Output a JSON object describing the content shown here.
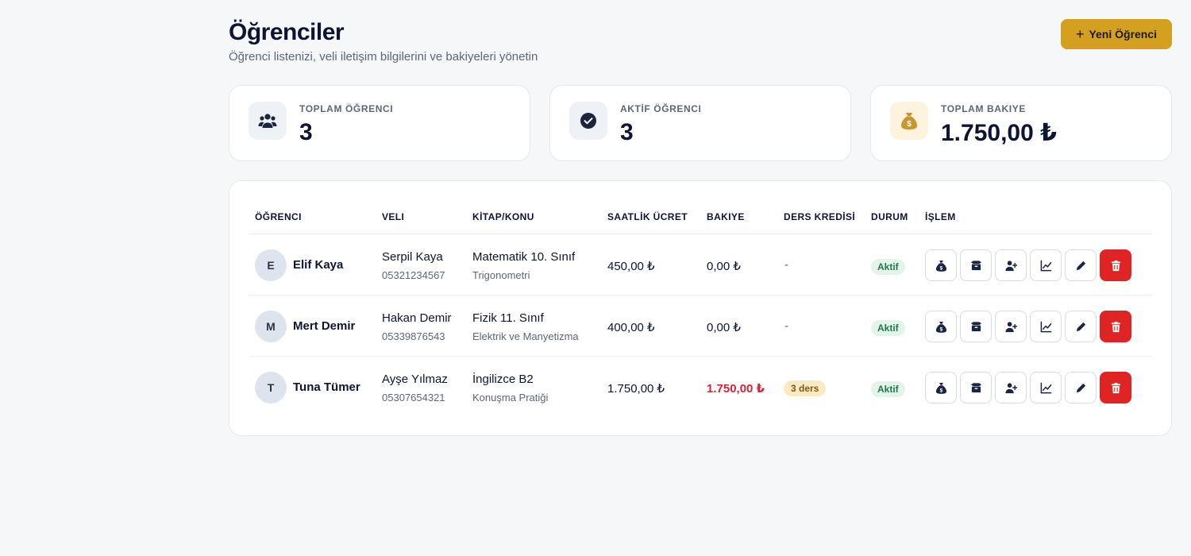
{
  "header": {
    "title": "Öğrenciler",
    "subtitle": "Öğrenci listenizi, veli iletişim bilgilerini ve bakiyeleri yönetin",
    "new_button_label": "Yeni Öğrenci",
    "new_button_icon": "plus-icon"
  },
  "stats": [
    {
      "label": "TOPLAM ÖĞRENCI",
      "value": "3",
      "icon": "users-icon"
    },
    {
      "label": "AKTİF ÖĞRENCI",
      "value": "3",
      "icon": "check-circle-icon"
    },
    {
      "label": "TOPLAM BAKIYE",
      "value": "1.750,00 ₺",
      "icon": "money-bag-icon"
    }
  ],
  "table": {
    "columns": [
      "ÖĞRENCI",
      "VELI",
      "KİTAP/KONU",
      "SAATLİK ÜCRET",
      "BAKIYE",
      "DERS KREDİSİ",
      "DURUM",
      "İŞLEM"
    ],
    "rows": [
      {
        "initial": "E",
        "name": "Elif Kaya",
        "parent": "Serpil Kaya",
        "phone": "05321234567",
        "book": "Matematik 10. Sınıf",
        "topic": "Trigonometri",
        "rate": "450,00 ₺",
        "balance": "0,00 ₺",
        "balance_negative": false,
        "credit": "-",
        "status": "Aktif"
      },
      {
        "initial": "M",
        "name": "Mert Demir",
        "parent": "Hakan Demir",
        "phone": "05339876543",
        "book": "Fizik 11. Sınıf",
        "topic": "Elektrik ve Manyetizma",
        "rate": "400,00 ₺",
        "balance": "0,00 ₺",
        "balance_negative": false,
        "credit": "-",
        "status": "Aktif"
      },
      {
        "initial": "T",
        "name": "Tuna Tümer",
        "parent": "Ayşe Yılmaz",
        "phone": "05307654321",
        "book": "İngilizce B2",
        "topic": "Konuşma Pratiği",
        "rate": "1.750,00 ₺",
        "balance": "1.750,00 ₺",
        "balance_negative": true,
        "credit": "3 ders",
        "status": "Aktif"
      }
    ],
    "actions": [
      "money-bag-icon",
      "box-icon",
      "user-plus-icon",
      "chart-line-icon",
      "pencil-icon",
      "trash-icon"
    ]
  },
  "colors": {
    "accent": "#d4a01f",
    "danger": "#e02424",
    "negative_balance": "#d0263a",
    "status_active_bg": "#e3f4ea",
    "status_active_text": "#1d7a45",
    "credit_bg": "#fbeac1"
  }
}
